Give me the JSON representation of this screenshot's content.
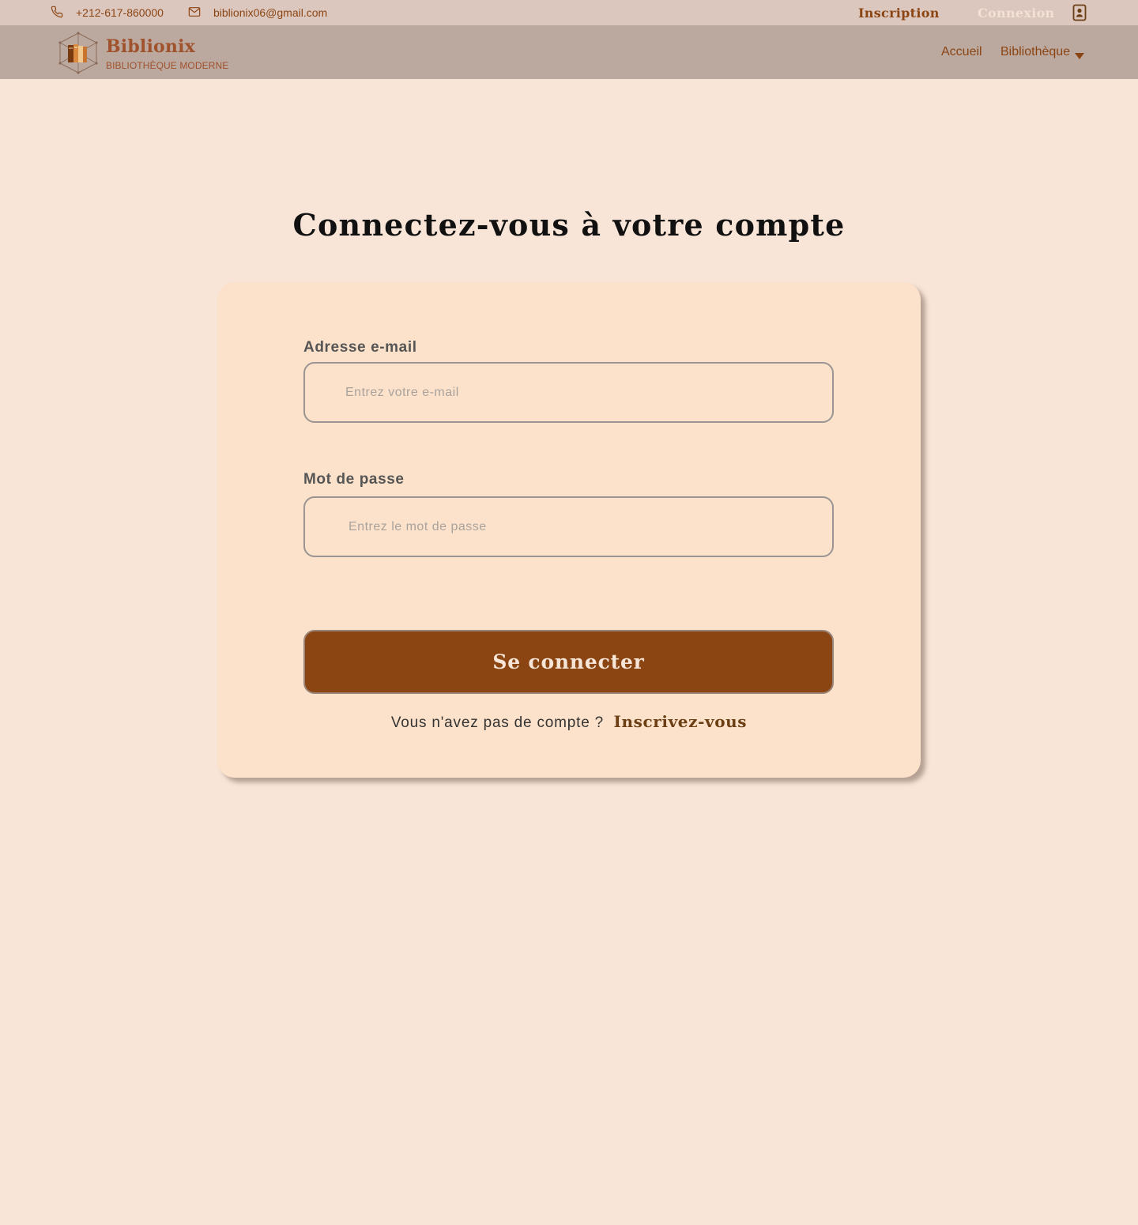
{
  "colors": {
    "page_background": "#f8e5d7",
    "topbar_background": "#dcc7bf",
    "navbar_background": "#bba89f",
    "card_background": "#fce2ca",
    "accent_brown": "#8b4513",
    "brand_sienna": "#a0522d",
    "link_dark_brown": "#6b3e14"
  },
  "topbar": {
    "phone_icon": "phone-icon",
    "phone": "+212-617-860000",
    "email_icon": "envelope-icon",
    "email": "biblionix06@gmail.com",
    "inscription_label": "Inscription",
    "connexion_label": "Connexion",
    "contact_card_icon": "contact-card-icon"
  },
  "navbar": {
    "logo_icon": "books-logo-icon",
    "brand_name": "Biblionix",
    "brand_tagline": "BIBLIOTHÈQUE MODERNE",
    "links": [
      {
        "label": "Accueil"
      },
      {
        "label": "Bibliothèque",
        "icon": "caret-down-icon"
      }
    ]
  },
  "main": {
    "title": "Connectez-vous à votre compte",
    "form": {
      "email_label": "Adresse e-mail",
      "email_value": "",
      "email_placeholder": "Entrez votre e-mail",
      "password_label": "Mot de passe",
      "password_value": "",
      "password_placeholder": "Entrez le mot de passe",
      "submit_label": "Se connecter",
      "signup_question": "Vous n'avez pas de compte ?",
      "signup_link": "Inscrivez-vous"
    }
  }
}
